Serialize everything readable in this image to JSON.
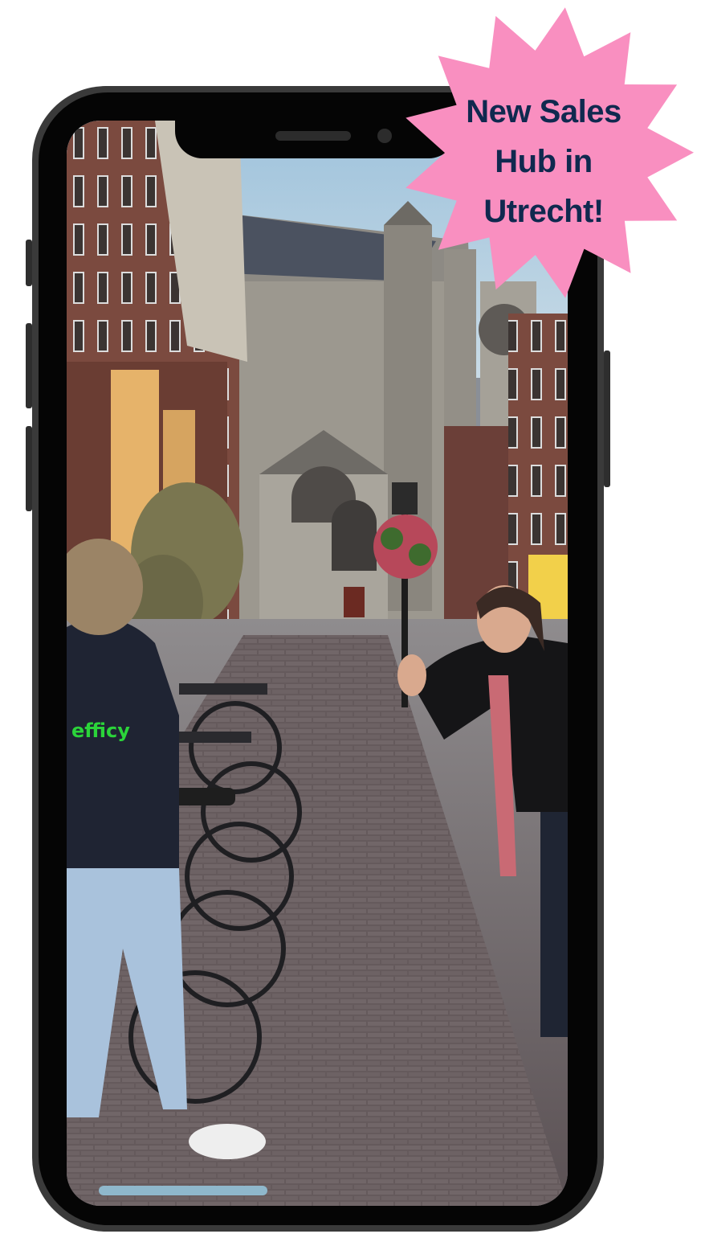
{
  "badge": {
    "lines": [
      "New Sales",
      "Hub in",
      "Utrecht!"
    ],
    "color": "#F98FC0",
    "text_color": "#10294F"
  },
  "photo": {
    "sweatshirt_logo": "efficy",
    "logo_color": "#2BD43A"
  }
}
